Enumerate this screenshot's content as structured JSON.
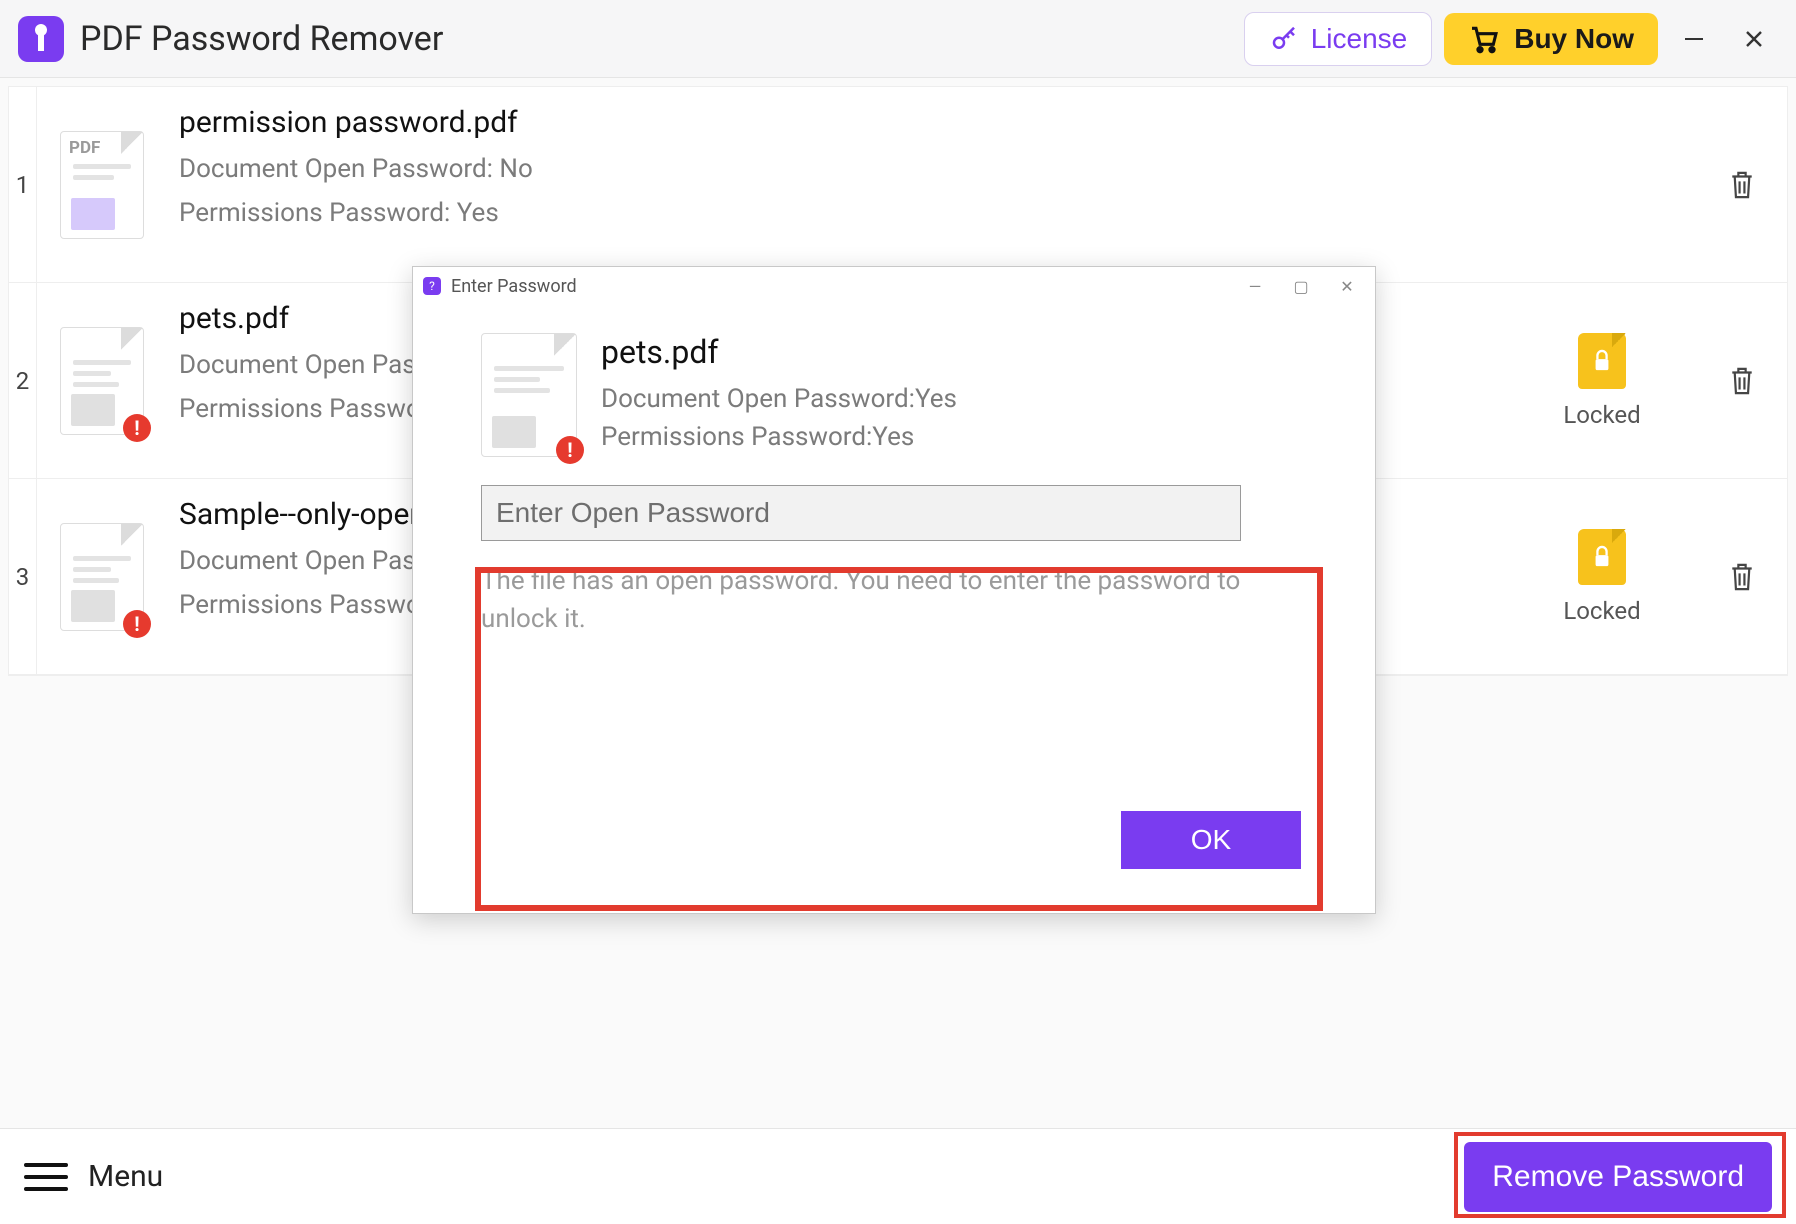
{
  "app": {
    "title": "PDF Password Remover"
  },
  "header": {
    "license_label": "License",
    "buynow_label": "Buy Now"
  },
  "files": [
    {
      "idx": "1",
      "name": "permission password.pdf",
      "open_pw": "Document Open Password: No",
      "perm_pw": "Permissions Password: Yes",
      "locked": false
    },
    {
      "idx": "2",
      "name": "pets.pdf",
      "open_pw": "Document Open Password: Yes",
      "perm_pw": "Permissions Password: Yes",
      "locked": true,
      "status": "Locked"
    },
    {
      "idx": "3",
      "name": "Sample--only-open-password.pdf",
      "open_pw": "Document Open Password: Yes",
      "perm_pw": "Permissions Password: No",
      "locked": true,
      "status": "Locked"
    }
  ],
  "footer": {
    "menu_label": "Menu",
    "remove_label": "Remove Password"
  },
  "modal": {
    "title": "Enter Password",
    "file_name": "pets.pdf",
    "open_pw": "Document Open Password:Yes",
    "perm_pw": "Permissions Password:Yes",
    "input_placeholder": "Enter Open Password",
    "hint": "The file has an open password. You need to enter the password to unlock it.",
    "ok_label": "OK"
  }
}
